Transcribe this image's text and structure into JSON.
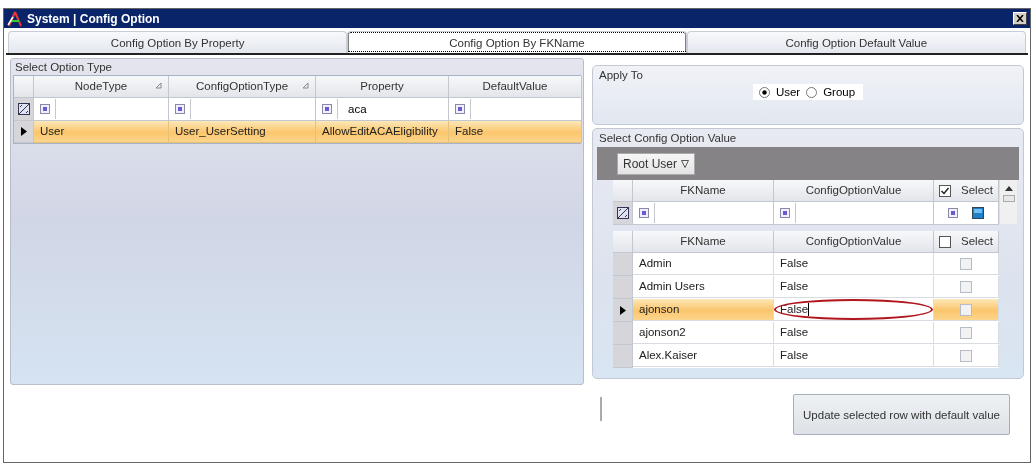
{
  "window": {
    "title": "System | Config Option"
  },
  "tabs": [
    {
      "label": "Config Option By Property",
      "selected": false
    },
    {
      "label": "Config Option By FKName",
      "selected": true
    },
    {
      "label": "Config Option Default Value",
      "selected": false
    }
  ],
  "option_type": {
    "title": "Select Option Type",
    "columns": [
      {
        "label": "NodeType",
        "sorted": true
      },
      {
        "label": "ConfigOptionType",
        "sorted": true
      },
      {
        "label": "Property",
        "sorted": false,
        "filter": "aca"
      },
      {
        "label": "DefaultValue",
        "sorted": false
      }
    ],
    "rows": [
      {
        "cells": [
          "User",
          "User_UserSetting",
          "AllowEditACAEligibility",
          "False"
        ],
        "selected": true
      }
    ]
  },
  "apply_to": {
    "title": "Apply To",
    "options": [
      {
        "label": "User",
        "selected": true
      },
      {
        "label": "Group",
        "selected": false
      }
    ]
  },
  "config_values": {
    "title": "Select Config Option Value",
    "group_button": "Root User",
    "filter_columns": [
      {
        "label": "FKName"
      },
      {
        "label": "ConfigOptionValue"
      },
      {
        "label": "Select",
        "checked": true
      }
    ],
    "columns": [
      {
        "label": "FKName"
      },
      {
        "label": "ConfigOptionValue"
      },
      {
        "label": "Select",
        "checked": false
      }
    ],
    "rows": [
      {
        "fkname": "Admin",
        "value": "False",
        "selected": false,
        "editing": false,
        "checked": false
      },
      {
        "fkname": "Admin Users",
        "value": "False",
        "selected": false,
        "editing": false,
        "checked": false
      },
      {
        "fkname": "ajonson",
        "value": "False",
        "selected": true,
        "editing": true,
        "checked": false
      },
      {
        "fkname": "ajonson2",
        "value": "False",
        "selected": false,
        "editing": false,
        "checked": false
      },
      {
        "fkname": "Alex.Kaiser",
        "value": "False",
        "selected": false,
        "editing": false,
        "checked": false
      }
    ]
  },
  "update_button": "Update selected row with default value"
}
